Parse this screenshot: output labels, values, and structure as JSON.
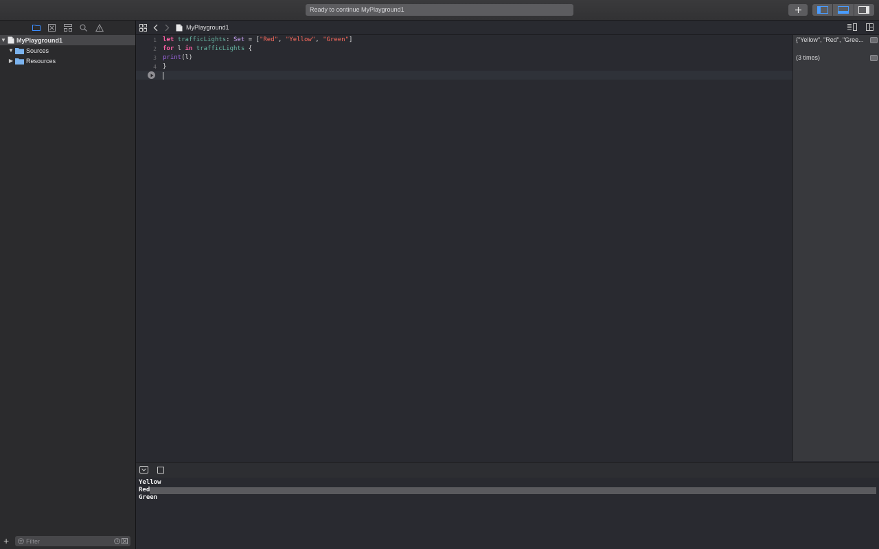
{
  "toolbar": {
    "activity_status": "Ready to continue MyPlayground1",
    "add_button": "+",
    "icons": [
      "plus-icon",
      "navigator-panel-icon",
      "debug-panel-icon",
      "inspector-panel-icon"
    ]
  },
  "navigator": {
    "tabs": [
      "folder-icon",
      "source-control-icon",
      "hierarchy-icon",
      "search-icon",
      "warning-icon"
    ],
    "tree": [
      {
        "label": "MyPlayground1",
        "expanded": true,
        "selected": true
      },
      {
        "label": "Sources",
        "expanded": true
      },
      {
        "label": "Resources",
        "expanded": false
      }
    ],
    "add_label": "+",
    "filter_placeholder": "Filter"
  },
  "jumpbar": {
    "file": "MyPlayground1",
    "icons": [
      "grid-icon",
      "back-chevron-icon",
      "forward-chevron-icon",
      "swift-file-icon",
      "assistant-editor-icon",
      "split-editor-icon"
    ]
  },
  "editor": {
    "line_numbers": [
      "1",
      "2",
      "3",
      "4"
    ],
    "lines": [
      [
        [
          "kw",
          "let"
        ],
        [
          "pl",
          " "
        ],
        [
          "vn",
          "trafficLights"
        ],
        [
          "pl",
          ": "
        ],
        [
          "ty",
          "Set"
        ],
        [
          "pl",
          " = ["
        ],
        [
          "str",
          "\"Red\""
        ],
        [
          "pl",
          ", "
        ],
        [
          "str",
          "\"Yellow\""
        ],
        [
          "pl",
          ", "
        ],
        [
          "str",
          "\"Green\""
        ],
        [
          "pl",
          "]"
        ]
      ],
      [
        [
          "kw",
          "for"
        ],
        [
          "pl",
          " l "
        ],
        [
          "kw",
          "in"
        ],
        [
          "pl",
          " "
        ],
        [
          "vn",
          "trafficLights"
        ],
        [
          "pl",
          " {"
        ]
      ],
      [
        [
          "fn",
          "print"
        ],
        [
          "pl",
          "(l)"
        ]
      ],
      [
        [
          "pl",
          "}"
        ]
      ]
    ],
    "colors": {
      "keyword": "#fc5fa3",
      "variable": "#67b7a4",
      "type": "#d0a8ff",
      "string": "#fc6a5d",
      "function": "#a167e6"
    }
  },
  "results": [
    {
      "text": "{\"Yellow\", \"Red\", \"Gree..."
    },
    {
      "text": "(3 times)"
    }
  ],
  "debug": {
    "icons": [
      "hide-debug-area-icon",
      "stop-icon"
    ]
  },
  "console": {
    "lines": [
      "Yellow",
      "Red",
      "Green"
    ]
  }
}
